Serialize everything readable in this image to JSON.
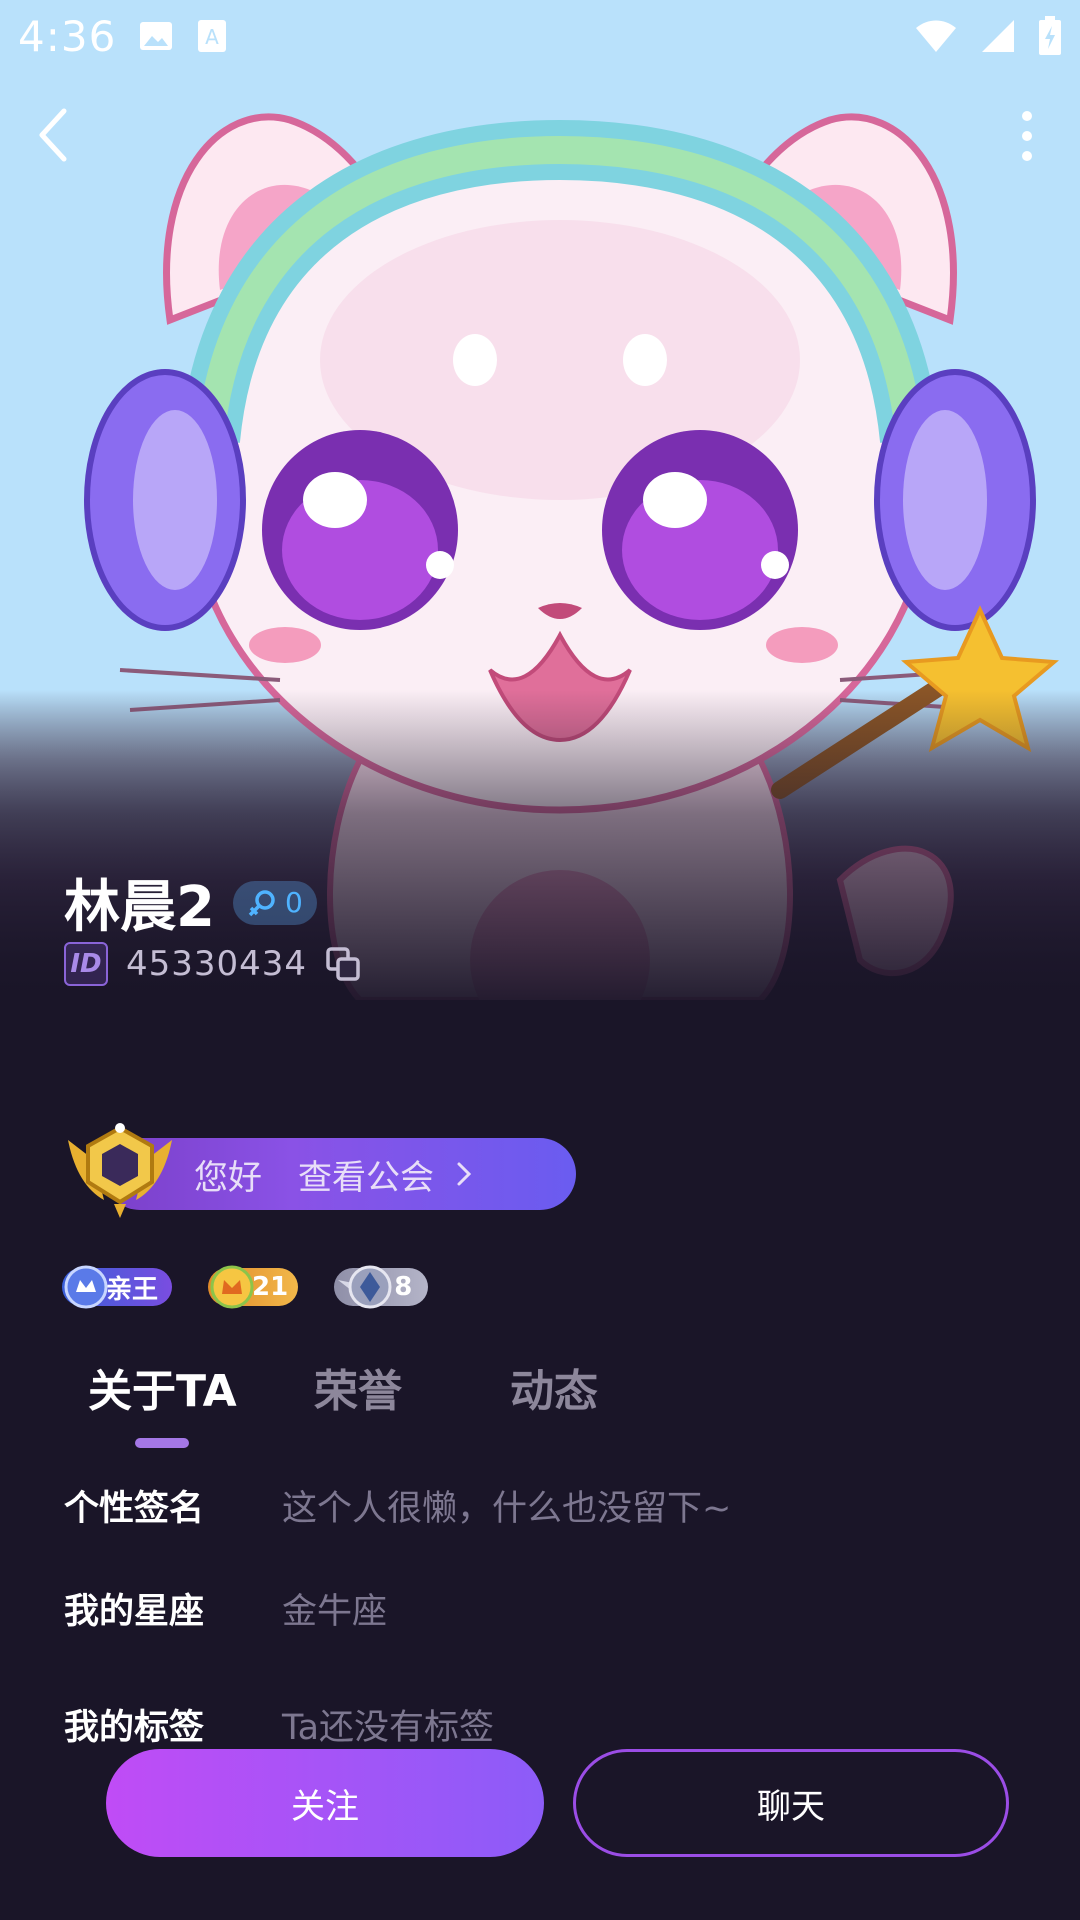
{
  "status_bar": {
    "time": "4:36"
  },
  "profile": {
    "name": "林晨2",
    "fans_count": "0",
    "id_tag": "ID",
    "id_value": "45330434"
  },
  "guild": {
    "greeting": "您好",
    "link_label": "查看公会"
  },
  "badges": [
    {
      "label": "亲王",
      "icon": "prince-icon"
    },
    {
      "label": "21",
      "icon": "crown-level-icon"
    },
    {
      "label": "8",
      "icon": "diamond-wing-icon"
    }
  ],
  "tabs": [
    {
      "label": "关于TA",
      "active": true
    },
    {
      "label": "荣誉",
      "active": false
    },
    {
      "label": "动态",
      "active": false
    }
  ],
  "info": [
    {
      "label": "个性签名",
      "value": "这个人很懒，什么也没留下~"
    },
    {
      "label": "我的星座",
      "value": "金牛座"
    },
    {
      "label": "我的标签",
      "value": "Ta还没有标签"
    }
  ],
  "actions": {
    "follow_label": "关注",
    "chat_label": "聊天"
  },
  "colors": {
    "background": "#1a1528",
    "hero_sky": "#b9e1fb",
    "accent_purple": "#a477e6",
    "follow_gradient_start": "#c04cf6",
    "follow_gradient_end": "#8c5cf8"
  }
}
